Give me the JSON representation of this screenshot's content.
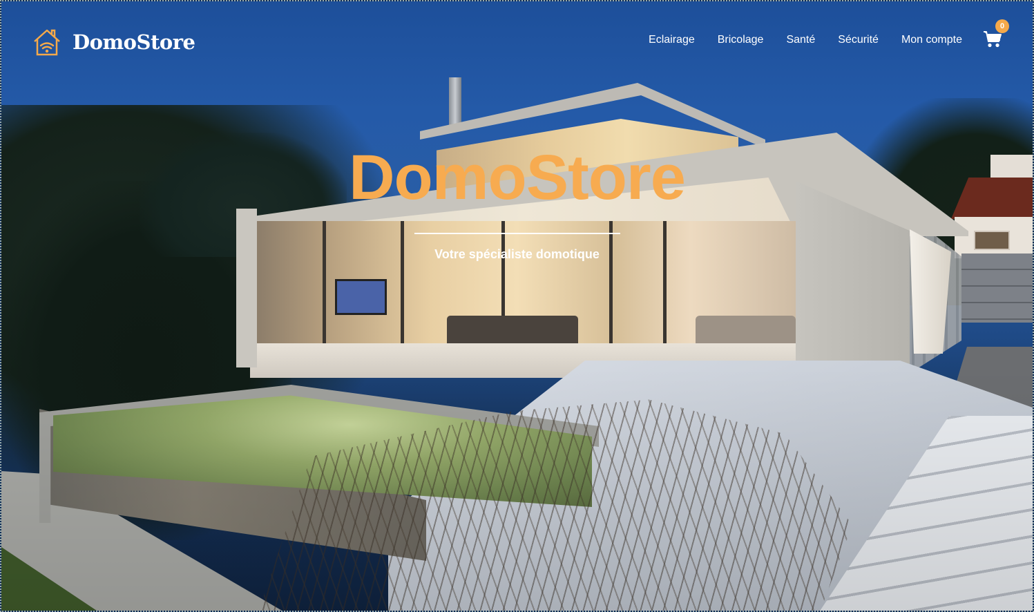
{
  "brand": {
    "name": "DomoStore",
    "logo_icon": "smart-home-icon",
    "accent_color": "#f7ab50"
  },
  "nav": {
    "items": [
      {
        "label": "Eclairage"
      },
      {
        "label": "Bricolage"
      },
      {
        "label": "Santé"
      },
      {
        "label": "Sécurité"
      },
      {
        "label": "Mon compte"
      }
    ],
    "cart": {
      "icon": "shopping-cart-icon",
      "count": "0",
      "badge_color": "#f5a94a"
    }
  },
  "hero": {
    "title": "DomoStore",
    "subtitle": "Votre spécialiste domotique"
  }
}
